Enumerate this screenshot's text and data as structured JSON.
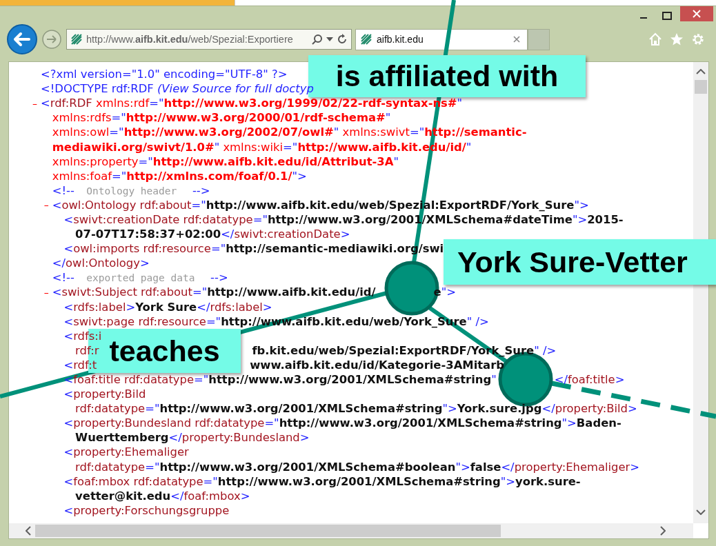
{
  "browser": {
    "address": "http://www.**aifb.kit.edu**/web/Spezial:Exportiere",
    "tabs": [
      {
        "title": "aifb.kit.edu",
        "selected": true
      }
    ]
  },
  "document": [
    {
      "lines": [
        [
          {
            "kind": "markup",
            "text": "<?xml version=\"1.0\" encoding=\"UTF-8\" ?>"
          }
        ]
      ]
    },
    {
      "lines": [
        [
          {
            "kind": "markup",
            "text": "<!DOCTYPE rdf:RDF "
          },
          {
            "kind": "note",
            "text": "(View Source for full doctyp"
          }
        ]
      ]
    },
    {
      "toggle": "–",
      "lines": [
        [
          {
            "kind": "markup",
            "text": "<"
          },
          {
            "kind": "name",
            "text": "rdf:RDF"
          },
          {
            "kind": "ns_attr",
            "text": " xmlns:rdf"
          },
          {
            "kind": "markup",
            "text": "=\""
          },
          {
            "kind": "ns_value",
            "text": "http://www.w3.org/1999/02/22-rdf-syntax-ns#"
          },
          {
            "kind": "markup",
            "text": "\""
          }
        ],
        [
          {
            "kind": "ns_attr",
            "text": "xmlns:rdfs"
          },
          {
            "kind": "markup",
            "text": "=\""
          },
          {
            "kind": "ns_value",
            "text": "http://www.w3.org/2000/01/rdf-schema#"
          },
          {
            "kind": "markup",
            "text": "\""
          }
        ],
        [
          {
            "kind": "ns_attr",
            "text": "xmlns:owl"
          },
          {
            "kind": "markup",
            "text": "=\""
          },
          {
            "kind": "ns_value",
            "text": "http://www.w3.org/2002/07/owl#"
          },
          {
            "kind": "markup",
            "text": "\""
          },
          {
            "kind": "ns_attr",
            "text": " xmlns:swivt"
          },
          {
            "kind": "markup",
            "text": "=\""
          },
          {
            "kind": "ns_value",
            "text": "http://semantic-"
          }
        ],
        [
          {
            "kind": "ns_value",
            "text": "mediawiki.org/swivt/1.0#"
          },
          {
            "kind": "markup",
            "text": "\""
          },
          {
            "kind": "ns_attr",
            "text": " xmlns:wiki"
          },
          {
            "kind": "markup",
            "text": "=\""
          },
          {
            "kind": "ns_value",
            "text": "http://www.aifb.kit.edu/id/"
          },
          {
            "kind": "markup",
            "text": "\""
          }
        ],
        [
          {
            "kind": "ns_attr",
            "text": "xmlns:property"
          },
          {
            "kind": "markup",
            "text": "=\""
          },
          {
            "kind": "ns_value",
            "text": "http://www.aifb.kit.edu/id/Attribut-3A"
          },
          {
            "kind": "markup",
            "text": "\""
          }
        ],
        [
          {
            "kind": "ns_attr",
            "text": "xmlns:foaf"
          },
          {
            "kind": "markup",
            "text": "=\""
          },
          {
            "kind": "ns_value",
            "text": "http://xmlns.com/foaf/0.1/"
          },
          {
            "kind": "markup",
            "text": "\">"
          }
        ]
      ],
      "children": [
        {
          "lines": [
            [
              {
                "kind": "markup",
                "text": "<!--"
              },
              {
                "kind": "comment",
                "text": "  Ontology header  "
              },
              {
                "kind": "markup",
                "text": " -->"
              }
            ]
          ]
        },
        {
          "toggle": "–",
          "lines": [
            [
              {
                "kind": "markup",
                "text": "<"
              },
              {
                "kind": "name",
                "text": "owl:Ontology rdf:about"
              },
              {
                "kind": "markup",
                "text": "=\""
              },
              {
                "kind": "value",
                "text": "http://www.aifb.kit.edu/web/Spezial:ExportRDF/York_Sure"
              },
              {
                "kind": "markup",
                "text": "\">"
              }
            ]
          ],
          "children": [
            {
              "lines": [
                [
                  {
                    "kind": "markup",
                    "text": "<"
                  },
                  {
                    "kind": "name",
                    "text": "swivt:creationDate rdf:datatype"
                  },
                  {
                    "kind": "markup",
                    "text": "=\""
                  },
                  {
                    "kind": "value",
                    "text": "http://www.w3.org/2001/XMLSchema#dateTime"
                  },
                  {
                    "kind": "markup",
                    "text": "\">"
                  },
                  {
                    "kind": "value",
                    "text": "2015-"
                  }
                ],
                [
                  {
                    "kind": "value",
                    "text": "07-07T17:58:37+02:00"
                  },
                  {
                    "kind": "markup",
                    "text": "</"
                  },
                  {
                    "kind": "name",
                    "text": "swivt:creationDate"
                  },
                  {
                    "kind": "markup",
                    "text": ">"
                  }
                ]
              ]
            },
            {
              "lines": [
                [
                  {
                    "kind": "markup",
                    "text": "<"
                  },
                  {
                    "kind": "name",
                    "text": "owl:imports rdf:resource"
                  },
                  {
                    "kind": "markup",
                    "text": "=\""
                  },
                  {
                    "kind": "value",
                    "text": "http://semantic-mediawiki.org/swi"
                  }
                ]
              ]
            }
          ],
          "close": [
            {
              "kind": "markup",
              "text": "</"
            },
            {
              "kind": "name",
              "text": "owl:Ontology"
            },
            {
              "kind": "markup",
              "text": ">"
            }
          ]
        },
        {
          "lines": [
            [
              {
                "kind": "markup",
                "text": "<!--"
              },
              {
                "kind": "comment",
                "text": "  exported page data  "
              },
              {
                "kind": "markup",
                "text": " -->"
              }
            ]
          ]
        },
        {
          "toggle": "–",
          "lines": [
            [
              {
                "kind": "markup",
                "text": "<"
              },
              {
                "kind": "name",
                "text": "swivt:Subject rdf:about"
              },
              {
                "kind": "markup",
                "text": "=\""
              },
              {
                "kind": "value",
                "text": "http://www.aifb.kit.edu/id/"
              },
              {
                "kind": "behind_node"
              },
              {
                "kind": "value",
                "text": "e"
              },
              {
                "kind": "markup",
                "text": "\">"
              }
            ]
          ],
          "children": [
            {
              "lines": [
                [
                  {
                    "kind": "markup",
                    "text": "<"
                  },
                  {
                    "kind": "name",
                    "text": "rdfs:label"
                  },
                  {
                    "kind": "markup",
                    "text": ">"
                  },
                  {
                    "kind": "content",
                    "text": "York Sure"
                  },
                  {
                    "kind": "markup",
                    "text": "</"
                  },
                  {
                    "kind": "name",
                    "text": "rdfs:label"
                  },
                  {
                    "kind": "markup",
                    "text": ">"
                  }
                ]
              ]
            },
            {
              "lines": [
                [
                  {
                    "kind": "markup",
                    "text": "<"
                  },
                  {
                    "kind": "name",
                    "text": "swivt:page rdf:resource"
                  },
                  {
                    "kind": "markup",
                    "text": "=\""
                  },
                  {
                    "kind": "value",
                    "text": "http://www.aifb.kit.edu/web/York_Sure"
                  },
                  {
                    "kind": "markup",
                    "text": "\" />"
                  }
                ]
              ]
            },
            {
              "lines": [
                [
                  {
                    "kind": "markup",
                    "text": "<"
                  },
                  {
                    "kind": "name",
                    "text": "rdfs:i"
                  }
                ],
                [
                  {
                    "kind": "name",
                    "text": "rdf:r"
                  },
                  {
                    "kind": "behind_label"
                  },
                  {
                    "kind": "value",
                    "text": "fb.kit.edu/web/Spezial:ExportRDF/York_Sure"
                  },
                  {
                    "kind": "markup",
                    "text": "\" />"
                  }
                ]
              ]
            },
            {
              "lines": [
                [
                  {
                    "kind": "markup",
                    "text": "<"
                  },
                  {
                    "kind": "name",
                    "text": "rdf:t"
                  },
                  {
                    "kind": "behind_label"
                  },
                  {
                    "kind": "value",
                    "text": "www.aifb.kit.edu/id/Kategorie-3AMitarb"
                  }
                ]
              ]
            },
            {
              "lines": [
                [
                  {
                    "kind": "markup",
                    "text": "<"
                  },
                  {
                    "kind": "name",
                    "text": "foaf:title rdf:datatype"
                  },
                  {
                    "kind": "markup",
                    "text": "=\""
                  },
                  {
                    "kind": "value",
                    "text": "http://www.w3.org/2001/XMLSchema#string"
                  },
                  {
                    "kind": "markup",
                    "text": "\""
                  },
                  {
                    "kind": "behind_node"
                  },
                  {
                    "kind": "markup",
                    "text": "</"
                  },
                  {
                    "kind": "name",
                    "text": "foaf:title"
                  },
                  {
                    "kind": "markup",
                    "text": ">"
                  }
                ]
              ]
            },
            {
              "lines": [
                [
                  {
                    "kind": "markup",
                    "text": "<"
                  },
                  {
                    "kind": "name",
                    "text": "property:Bild"
                  }
                ],
                [
                  {
                    "kind": "name",
                    "text": "rdf:datatype"
                  },
                  {
                    "kind": "markup",
                    "text": "=\""
                  },
                  {
                    "kind": "value",
                    "text": "http://www.w3.org/2001/XMLSchema#string"
                  },
                  {
                    "kind": "markup",
                    "text": "\">"
                  },
                  {
                    "kind": "value",
                    "text": "York.sure.jpg"
                  },
                  {
                    "kind": "markup",
                    "text": "</"
                  },
                  {
                    "kind": "name",
                    "text": "property:Bild"
                  },
                  {
                    "kind": "markup",
                    "text": ">"
                  }
                ]
              ]
            },
            {
              "lines": [
                [
                  {
                    "kind": "markup",
                    "text": "<"
                  },
                  {
                    "kind": "name",
                    "text": "property:Bundesland rdf:datatype"
                  },
                  {
                    "kind": "markup",
                    "text": "=\""
                  },
                  {
                    "kind": "value",
                    "text": "http://www.w3.org/2001/XMLSchema#string"
                  },
                  {
                    "kind": "markup",
                    "text": "\">"
                  },
                  {
                    "kind": "value",
                    "text": "Baden-"
                  }
                ],
                [
                  {
                    "kind": "value",
                    "text": "Wuerttemberg"
                  },
                  {
                    "kind": "markup",
                    "text": "</"
                  },
                  {
                    "kind": "name",
                    "text": "property:Bundesland"
                  },
                  {
                    "kind": "markup",
                    "text": ">"
                  }
                ]
              ]
            },
            {
              "lines": [
                [
                  {
                    "kind": "markup",
                    "text": "<"
                  },
                  {
                    "kind": "name",
                    "text": "property:Ehemaliger"
                  }
                ],
                [
                  {
                    "kind": "name",
                    "text": "rdf:datatype"
                  },
                  {
                    "kind": "markup",
                    "text": "=\""
                  },
                  {
                    "kind": "value",
                    "text": "http://www.w3.org/2001/XMLSchema#boolean"
                  },
                  {
                    "kind": "markup",
                    "text": "\">"
                  },
                  {
                    "kind": "value",
                    "text": "false"
                  },
                  {
                    "kind": "markup",
                    "text": "</"
                  },
                  {
                    "kind": "name",
                    "text": "property:Ehemaliger"
                  },
                  {
                    "kind": "markup",
                    "text": ">"
                  }
                ]
              ]
            },
            {
              "lines": [
                [
                  {
                    "kind": "markup",
                    "text": "<"
                  },
                  {
                    "kind": "name",
                    "text": "foaf:mbox rdf:datatype"
                  },
                  {
                    "kind": "markup",
                    "text": "=\""
                  },
                  {
                    "kind": "value",
                    "text": "http://www.w3.org/2001/XMLSchema#string"
                  },
                  {
                    "kind": "markup",
                    "text": "\">"
                  },
                  {
                    "kind": "value",
                    "text": "york.sure-"
                  }
                ],
                [
                  {
                    "kind": "value",
                    "text": "vetter@kit.edu"
                  },
                  {
                    "kind": "markup",
                    "text": "</"
                  },
                  {
                    "kind": "name",
                    "text": "foaf:mbox"
                  },
                  {
                    "kind": "markup",
                    "text": ">"
                  }
                ]
              ]
            },
            {
              "lines": [
                [
                  {
                    "kind": "markup",
                    "text": "<"
                  },
                  {
                    "kind": "name",
                    "text": "property:Forschungsgruppe"
                  }
                ]
              ]
            }
          ]
        }
      ]
    }
  ],
  "graph": {
    "labels": [
      {
        "kind": "edge",
        "text": "is affiliated with"
      },
      {
        "kind": "node",
        "text": "York Sure-Vetter"
      },
      {
        "kind": "edge",
        "text": "teaches"
      }
    ]
  }
}
